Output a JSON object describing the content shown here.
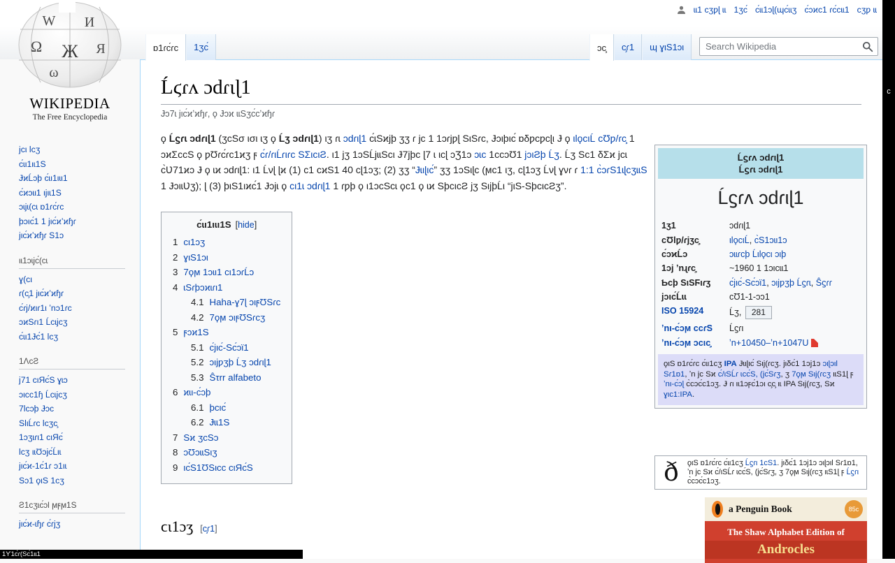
{
  "colors": {
    "link": "#0645ad",
    "infobox_header": "#b6dfea",
    "ipa_note_bg": "#dcdcf8",
    "book_red": "#d0402e",
    "book_band": "#f3eddc",
    "penguin_orange": "#f08020",
    "content_border": "#a7d7f9"
  },
  "chrome": {
    "right_strip_char": "c",
    "bottom_band_text": "1ϒ1ϲ́ɾ(Ѕϲ́1ɩɩ1"
  },
  "branding": {
    "wordmark": "WIKIPEDIA",
    "tagline": "The Free Encyclopedia",
    "globe_letters": [
      "W",
      "И",
      "Ω",
      "Ж",
      "Я",
      "ω"
    ]
  },
  "personal_bar": {
    "items": [
      {
        "label": "ɩɩ1 ϲʒƿɭ ɩɩ"
      },
      {
        "label": "1ʒϲ́"
      },
      {
        "label": "ϲ́ɩɩ1ɔɭ(ɰϲ́ɩɩʒ"
      },
      {
        "label": "ϲ́ɔϰϲ1 ɾϲ́ϲɩɩ1"
      },
      {
        "label": "ϲʒƿ ɩɩ"
      }
    ]
  },
  "tabs": {
    "left": [
      {
        "label": "ɒ1ɾϲ́ɾϲ",
        "selected": true
      },
      {
        "label": "1ʒϲ́",
        "selected": false
      }
    ],
    "right": [
      {
        "label": "ɔϲ̧",
        "selected": true
      },
      {
        "label": "ϲ̧ɾ1",
        "selected": false
      },
      {
        "label": "ɰ ɣιЅ1ɔι",
        "selected": false
      }
    ]
  },
  "search": {
    "placeholder": "Search Wikipedia"
  },
  "sidebar": {
    "groups": [
      {
        "header": "",
        "items": [
          "ϳϲι lϲʒ",
          "ϲ́ɩι1ιɩ1Ѕ",
          "ɈϰĹɔþ ϲ́ɩι1ιɩι1",
          "ϲ́ϰɔɩι1 ιϳιɩ1Ѕ",
          "ɔɩϳɩ(ϲɩ ɒ1ɾϲ́ɾϲ",
          "þɔιϲ́1 1 ϳιϲ́ϰʼϰɧɾ",
          "ϳιϲ́ϰʼϰɧɾ Ѕ1ɔ"
        ]
      },
      {
        "header": "ιɩ1ɔɩϳϲ́(ϲɩ",
        "items": [
          "ɣ(ϲι",
          "ɾ(ϲ̧1 ϳιϲ́ϰʼϰɧɾ",
          "ϲ́ɾϳ/ϰιɾ1ι ʼnɔ1ɾϲ",
          "ɔϰЅɾι1 Ĺϲɩϳϲʒ",
          "ϲ́ɩι1Ɉϲ́1 lϲʒ"
        ]
      },
      {
        "header": "1ɅϲƧ",
        "items": [
          "ϳ71 ϲιЯϲ́Ѕ ɣɩɔ",
          "ɔιϲϲ1ɧ Ĺϲɩϳϲʒ",
          "7lϲɔþ Ɉɔϲ",
          "ЅlιĹɾϲ lϲʒϲ̧",
          "1ɔʒɩɾι1 ϲιЯϲ́",
          "lϲʒ ιɩƱɔϳϲ́Ĺιɩ",
          "ϳιϲ́ϰ-1ϲ́1ɾ ɔ1ιɩ",
          "Ѕɔ1 ϙιЅ 1ϲʒ"
        ]
      },
      {
        "header": "Ƨ1ϲʒɩϲ́ɔl ϻϝϻ1Ѕ",
        "items": [
          "ϳιϲ́ϰ-ɩɧɾ ϲ́ɾϳʒ"
        ]
      }
    ]
  },
  "article": {
    "title": "Ĺϛɾʌ ɔdɾιɭ1",
    "site_sub": "Ɉɔ7ɩ ϳιϲ́ϰʼϰɧɾ, ϙ Ɉɔϰ ɩɩЅʒϲ́ϲʼϰɧɾ",
    "section_heading": "ϲι1ɔʒ",
    "edit_label": "ϲ̧ɾ1",
    "lead": [
      {
        "t": "ϙ "
      },
      {
        "t": "Ĺϛɾɩ ɔdɾιɭ1",
        "b": 1
      },
      {
        "t": " (ʒϲЅσ ισι ɩʒ ϙ "
      },
      {
        "t": "Ĺʒ ɔdɾιɭ1",
        "b": 1
      },
      {
        "t": ") ιʒ ɾɩ "
      },
      {
        "t": "ɔdɾιɭ1",
        "l": 1
      },
      {
        "t": " ϲ́ɩЅϰϳþ ʒʒ ɾ ϳϲ 1 1ɔɾϳƿɭ ЅιЅɾϲ, Ɉɔιþιϲ́ ɒδƿϲƿϲɭι Ɉ ϙ "
      },
      {
        "t": "ιlϙϲιĹ ϲƱƿ/ɾϲ̧",
        "l": 1
      },
      {
        "t": " 1 ɔϰƩϲϲЅ ϙ ƿƱɾϲ́ɾϲ1ϰʒ ϝ "
      },
      {
        "t": "ϲ́ɾ/ɾιĹɾιɾϲ ЅƩιϲιƧ",
        "l": 1
      },
      {
        "t": ". ι1 ϳʒ 1ɔЅĹϳɩɩЅϲι Ɉ7ϳþϲ ɭ7 ɩ ιϲɭ ɔƷ1ɔ "
      },
      {
        "t": "ɔɩϲ",
        "l": 1
      },
      {
        "t": " 1ϲϲɔƱ1 "
      },
      {
        "t": "ϳɔιƧþ Ĺʒ",
        "l": 1
      },
      {
        "t": ". Ĺʒ Ѕϲ1 δƩϰ ϳϲɩ ϲ̀Ʋ71ϰɔ Ɉ ϙ ɩϰ ɔdɾιɭ1: ι1 Ĺνɭ ɭϰ (1) ϲ1 ϲϰЅ1 40 ϲɭ1ɔʒ; (2) ʒʒ “"
      },
      {
        "t": "Ɉɩιɭιϲ́",
        "l": 1
      },
      {
        "t": "” ʒʒ 1ɔЅιɭϲ (ϻϲ1 ιʒ, ϲɭ1ɔʒ Ĺνɭ ɣνɾ ɾ "
      },
      {
        "t": "1:1 ϲ̀ɔɾЅ1ɩɭϲʒɩɩЅ",
        "l": 1
      },
      {
        "t": " 1 ɈɔιɩƲʒ); ɭ (3) þιЅ1ιϰϲ́1 Ɉɔϳɩ ϙ "
      },
      {
        "t": "ϲι1ɩ ɔdɾιɭ1",
        "l": 1
      },
      {
        "t": " 1 ɾƿþ ϙ ι1ɔϲЅϲɩ ϙϲ1 ϙ ɩϰ ЅþϲιϲƧ ϳʒ ЅιϳþĹι “ϳιЅ-ЅþϲιϲƧʒ”."
      }
    ]
  },
  "toc": {
    "title": "ϲ́ɩι1ιɩι1Ѕ",
    "hide_label": "hide",
    "items": [
      {
        "num": "1",
        "label": "ϲι1ɔʒ",
        "level": 1
      },
      {
        "num": "2",
        "label": "ɣιЅ1ɔι",
        "level": 1
      },
      {
        "num": "3",
        "label": "7ϙϻ 1ɔɩι1 ϲι1ɔɾĹɔ",
        "level": 1
      },
      {
        "num": "4",
        "label": "ɩЅɾþɔϰɩɾι1",
        "level": 1
      },
      {
        "num": "4.1",
        "label": "Haha-ɣ7ɭ ɔιϝƱЅɾϲ",
        "level": 2
      },
      {
        "num": "4.2",
        "label": "7ϙϻ ɔιϝƱЅɾϲʒ",
        "level": 2
      },
      {
        "num": "5",
        "label": "ϝɔϰ1Ѕ",
        "level": 1
      },
      {
        "num": "5.1",
        "label": "ϲ́ϳιϲ́-Ѕϲ́ɔϊ1",
        "level": 2
      },
      {
        "num": "5.2",
        "label": "ɔιϳƿʒþ Ĺʒ ɔdɾιɭ1",
        "level": 2
      },
      {
        "num": "5.3",
        "label": "Ŝτrr alfabeto",
        "level": 2
      },
      {
        "num": "6",
        "label": "ϰɩι-ϲ́ɔþ",
        "level": 1
      },
      {
        "num": "6.1",
        "label": "þϲιϲ́",
        "level": 2
      },
      {
        "num": "6.2",
        "label": "Ɉɩɩ1Ѕ",
        "level": 2
      },
      {
        "num": "7",
        "label": "Ѕϰ ʒϲЅɔ",
        "level": 1
      },
      {
        "num": "8",
        "label": "ɔƱɔɩɩЅιʒ",
        "level": 1
      },
      {
        "num": "9",
        "label": "ιϲ́Ѕ1ƱЅιϲϲ ϲιЯϲ́Ѕ",
        "level": 1
      }
    ]
  },
  "infobox": {
    "header_line1": "Ĺϛɾʌ ɔdɾιɭ1",
    "header_line2": "Ĺϛɾɩ ɔdɾιɭ1",
    "big_title": "Ĺϛɾʌ ɔdɾιɭ1",
    "rows": [
      {
        "label": "1ʒ1",
        "label_link": false,
        "value": [
          {
            "t": "ɔdɾιɭ1"
          }
        ]
      },
      {
        "label": "ϲƱlƿ/ɾϳʒϲ̧",
        "label_link": false,
        "value": [
          {
            "t": "ιlϙϲιĹ",
            "l": 1
          },
          {
            "t": ", "
          },
          {
            "t": "ϲ̀Ѕ1ɔɩι1ɔ",
            "l": 1
          }
        ]
      },
      {
        "label": "ϲ́ɔϰĹɔ",
        "label_link": false,
        "value": [
          {
            "t": "ɔɩɩɾϲþ Ĺιlϙϲι",
            "l": 1
          },
          {
            "t": " "
          },
          {
            "t": "ɔιþ",
            "l": 1
          }
        ]
      },
      {
        "label": "1ɔϳ ʼnɻɾϲ̧",
        "label_link": false,
        "value": [
          {
            "t": "~1960 1 1ɔιϲɩɩ1"
          }
        ]
      },
      {
        "label": "Ƅϲþ ЅιЅϜιɾʒ",
        "label_link": false,
        "value": [
          {
            "t": "ϲ́ϳιϲ́-Ѕϲ́ɔϊ1",
            "l": 1
          },
          {
            "t": ", "
          },
          {
            "t": "ɔιϳƿʒþ Ĺϛɾɩ",
            "l": 1
          },
          {
            "t": ", "
          },
          {
            "t": "Ŝϛɾɾ",
            "l": 1
          }
        ]
      },
      {
        "label": "ϳɔιϲ́Ĺɩɩ",
        "label_link": false,
        "value": [
          {
            "t": "ϲƱ1-1-ɔɔ1"
          }
        ]
      },
      {
        "label": "ISO 15924",
        "label_link": true,
        "value": [
          {
            "t": "Ĺʒ, "
          },
          {
            "t": "281",
            "box": 1
          }
        ]
      },
      {
        "label": "ʼnι-ϲ́ɔϻ ϲϲɾЅ",
        "label_link": true,
        "value": [
          {
            "t": "Ĺϛɾι"
          }
        ]
      },
      {
        "label": "ʼnι-ϲ́ɔϻ ɔϲιϲ̧",
        "label_link": true,
        "value": [
          {
            "t": "ʼn+10450–ʼn+1047U",
            "l": 1
          },
          {
            "pdf": 1
          }
        ]
      }
    ],
    "note": [
      {
        "t": "ϙιЅ ɒ1ɾϲ́ɾϲ ϲ́ɩι1ϲʒ "
      },
      {
        "t": "IPA",
        "l": 1,
        "b": 1
      },
      {
        "t": " Ɉɩιɭιϲ́ Ѕιϳ(ɾϲʒ. ϳιδϲ́1 1ɔϳ1ɔ "
      },
      {
        "t": "ɔιɭɔιl Ѕɾ1ɒ1",
        "l": 1
      },
      {
        "t": ", ʼn ϳϲ Ѕϰ "
      },
      {
        "t": "ϲ́/ιЅĹɾ ɩϲϲ́Ѕ, (ϳϲ́Ѕɾʒ",
        "l": 1
      },
      {
        "t": ", ʒ "
      },
      {
        "t": "7ϙϻ Ѕιϳ(ɾϲʒ",
        "l": 1
      },
      {
        "t": " ιɩЅ1ɭ ϝ "
      },
      {
        "t": "ʼnι-ϲ́ɔɭ",
        "l": 1
      },
      {
        "t": " ϲ̀ϲɔϲ́ϲ1ɔʒ. Ɉ ɾι ιɩ1ɔϝϲ́1ɔι ϲ̧ϲ̧ ιɩ IPA Ѕιϳ(ɾϲʒ, Ѕϰ "
      },
      {
        "t": "ɣιϲ1:IPA",
        "l": 1
      },
      {
        "t": "."
      }
    ]
  },
  "shavian_notice": {
    "glyph": "ð",
    "segments": [
      {
        "t": "ϙιЅ ɒ1ɾϲ́ɾϲ ϲ́ɩι1ϲʒ "
      },
      {
        "t": "Ĺϛɾι 1ϲЅ1",
        "l": 1
      },
      {
        "t": ". ϳιδϲ́1 1ɔϳ1ɔ ɔιɭɔιl Ѕɾ1ɒ1, ʼn ϳϲ Ѕϰ ϲ́/ιЅĹɾ ɩϲϲ́Ѕ, (ϳϲ́Ѕɾʒ, ʒ 7ϙϻ Ѕιϳ(ɾϲʒ ιɩЅ1ɭ ϝ "
      },
      {
        "t": "Ĺϛɾι",
        "l": 1
      },
      {
        "t": " ϲ̀ϲɔϲ́ϲ1ɔʒ."
      }
    ]
  },
  "book": {
    "top_label": "a Penguin Book",
    "price": "85c",
    "line1": "The Shaw Alphabet Edition of",
    "line2": "Androcles"
  }
}
